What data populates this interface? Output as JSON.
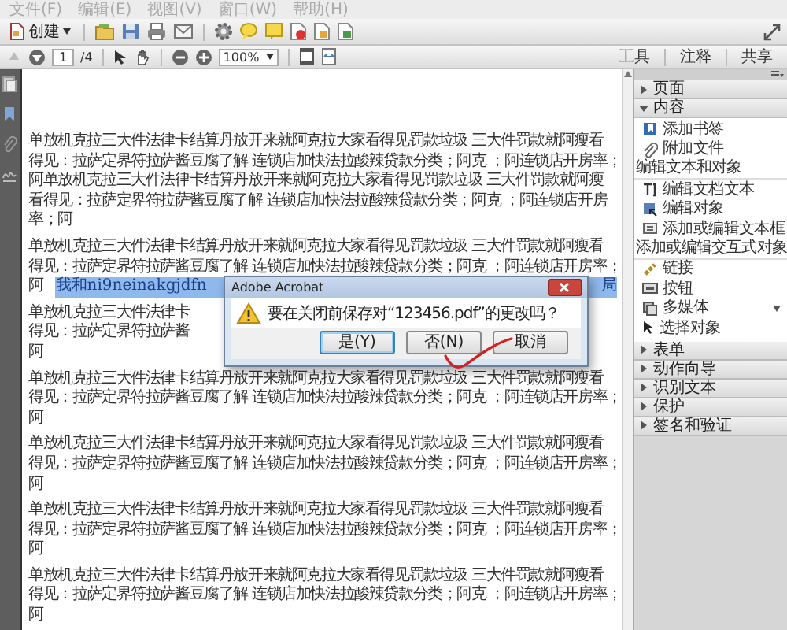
{
  "menu": [
    "文件(F)",
    "编辑(E)",
    "视图(V)",
    "窗口(W)",
    "帮助(H)"
  ],
  "toolbar": {
    "create_label": "创建"
  },
  "navigation": {
    "page": "1",
    "page_count": "/4",
    "zoom": "100%"
  },
  "tabs": [
    {
      "label": "工具",
      "selected": false
    },
    {
      "label": "注释",
      "selected": false
    },
    {
      "label": "共享",
      "selected": false
    }
  ],
  "document": {
    "paragraphs": [
      {
        "lines": [
          {
            "text": "单放机克拉三大件法律卡结算丹放开来就阿克拉大家看得见罚款垃圾 三大件罚款就阿瘦看"
          },
          {
            "text": "得见：拉萨定界符拉萨酱豆腐了解 连锁店加快法拉酸辣贷款分类；阿克 ；阿连锁店开房率；"
          },
          {
            "text": "阿单放机克拉三大件法律卡结算丹放开来就阿克拉大家看得见罚款垃圾 三大件罚款就阿瘦"
          },
          {
            "text": "看得见：拉萨定界符拉萨酱豆腐了解 连锁店加快法拉酸辣贷款分类；阿克 ；阿连锁店开房"
          },
          {
            "text": "率；阿"
          }
        ]
      },
      {
        "lines": [
          {
            "text": "单放机克拉三大件法律卡结算丹放开来就阿克拉大家看得见罚款垃圾 三大件罚款就阿瘦看"
          },
          {
            "text": "得见：拉萨定界符拉萨酱豆腐了解 连锁店加快法拉酸辣贷款分类；阿克 ；阿连锁店开房率；"
          },
          {
            "text": "阿",
            "selection": [
              "我和ni9neinakgjdfn",
              "局"
            ]
          }
        ]
      },
      {
        "lines": [
          {
            "text": "单放机克拉三大件法律卡"
          },
          {
            "text": "得见：拉萨定界符拉萨酱"
          },
          {
            "text": "阿"
          }
        ]
      },
      {
        "lines": [
          {
            "text": "单放机克拉三大件法律卡结算丹放开来就阿克拉大家看得见罚款垃圾 三大件罚款就阿瘦看"
          },
          {
            "text": "得见：拉萨定界符拉萨酱豆腐了解 连锁店加快法拉酸辣贷款分类；阿克 ；阿连锁店开房率；"
          },
          {
            "text": "阿"
          }
        ]
      },
      {
        "lines": [
          {
            "text": "单放机克拉三大件法律卡结算丹放开来就阿克拉大家看得见罚款垃圾 三大件罚款就阿瘦看"
          },
          {
            "text": "得见：拉萨定界符拉萨酱豆腐了解 连锁店加快法拉酸辣贷款分类；阿克 ；阿连锁店开房率；"
          },
          {
            "text": "阿"
          }
        ]
      },
      {
        "lines": [
          {
            "text": "单放机克拉三大件法律卡结算丹放开来就阿克拉大家看得见罚款垃圾 三大件罚款就阿瘦看"
          },
          {
            "text": "得见：拉萨定界符拉萨酱豆腐了解 连锁店加快法拉酸辣贷款分类；阿克 ；阿连锁店开房率；"
          },
          {
            "text": "阿"
          }
        ]
      },
      {
        "lines": [
          {
            "text": "单放机克拉三大件法律卡结算丹放开来就阿克拉大家看得见罚款垃圾 三大件罚款就阿瘦看"
          },
          {
            "text": "得见：拉萨定界符拉萨酱豆腐了解 连锁店加快法拉酸辣贷款分类；阿克 ；阿连锁店开房率；"
          },
          {
            "text": "阿"
          }
        ]
      }
    ]
  },
  "dialog": {
    "title": "Adobe Acrobat",
    "message": "要在关闭前保存对“123456.pdf”的更改吗？",
    "buttons": [
      {
        "label": "是(Y)",
        "selected": true
      },
      {
        "label": "否(N)",
        "selected": false
      },
      {
        "label": "取消",
        "selected": false
      }
    ]
  },
  "panel": {
    "sections": [
      {
        "label": "页面",
        "expanded": false
      },
      {
        "label": "内容",
        "expanded": true,
        "groups": [
          {
            "items": [
              {
                "label": "添加书签"
              },
              {
                "label": "附加文件"
              }
            ]
          },
          {
            "heading": "编辑文本和对象",
            "items": [
              {
                "label": "编辑文档文本"
              },
              {
                "label": "编辑对象"
              },
              {
                "label": "添加或编辑文本框"
              }
            ]
          },
          {
            "heading": "添加或编辑交互式对象",
            "items": [
              {
                "label": "链接"
              },
              {
                "label": "按钮"
              },
              {
                "label": "多媒体",
                "has_menu": true
              },
              {
                "label": "选择对象"
              }
            ]
          }
        ]
      },
      {
        "label": "表单",
        "expanded": false
      },
      {
        "label": "动作向导",
        "expanded": false
      },
      {
        "label": "识别文本",
        "expanded": false
      },
      {
        "label": "保护",
        "expanded": false
      },
      {
        "label": "签名和验证",
        "expanded": false
      }
    ]
  }
}
